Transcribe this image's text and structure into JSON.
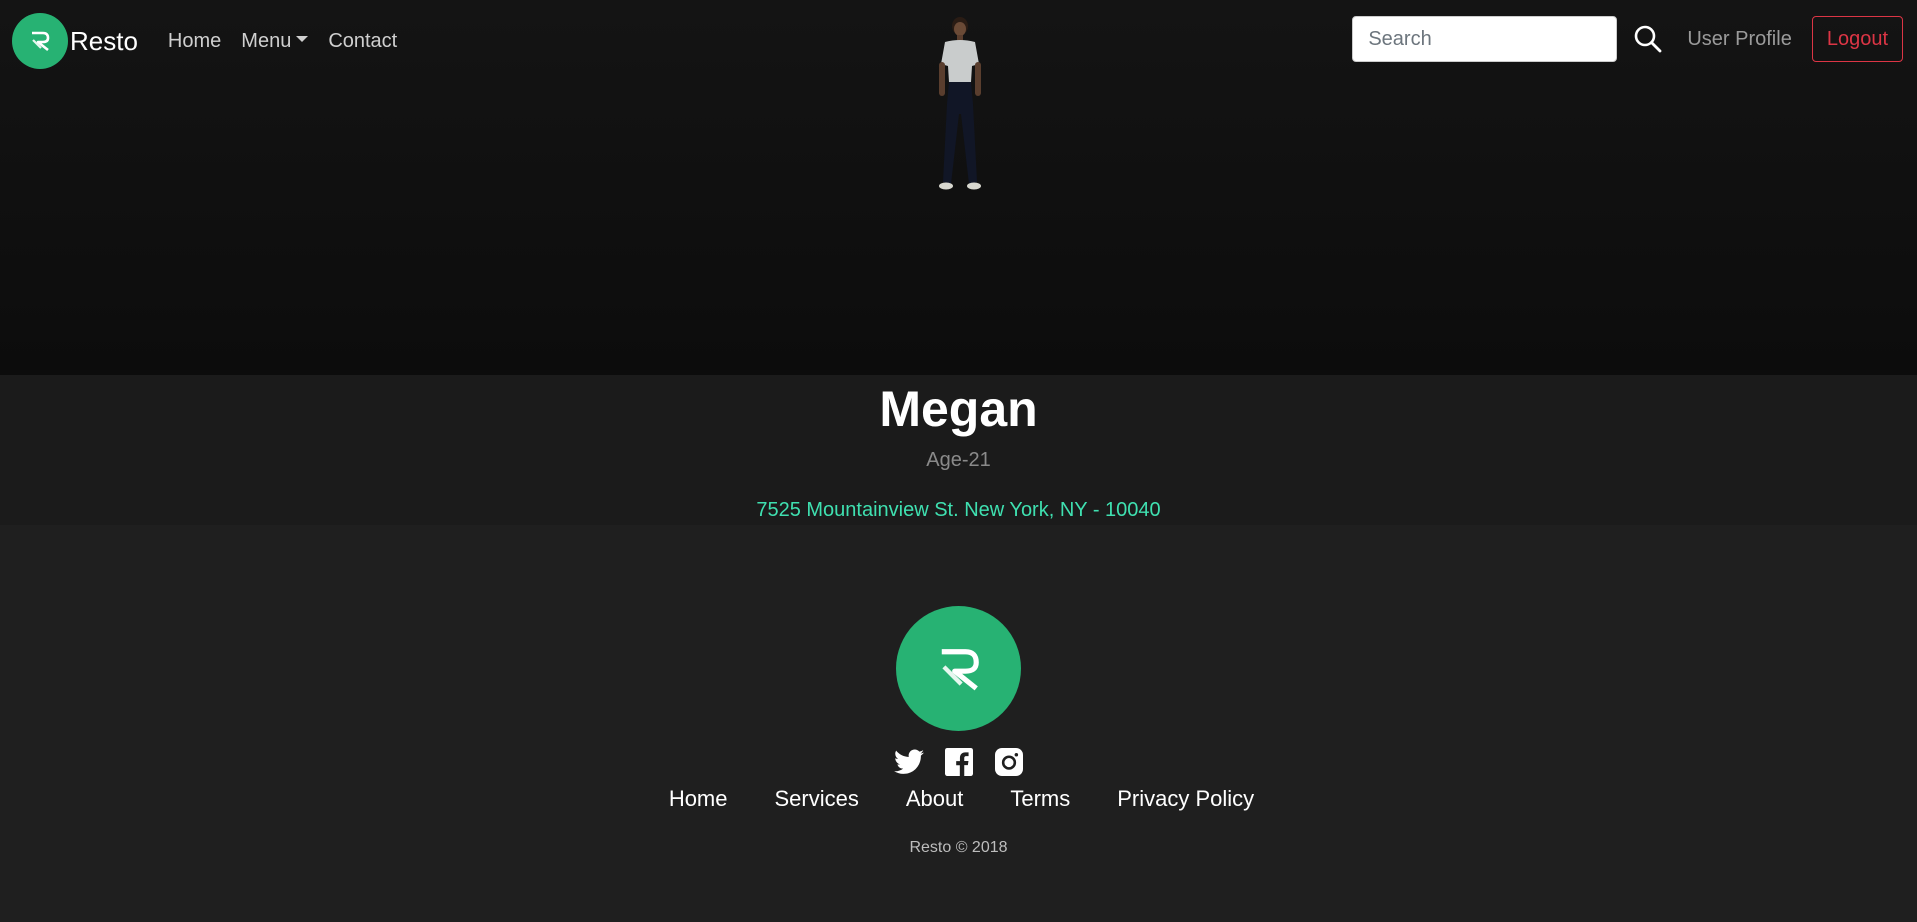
{
  "brand": {
    "name": "Resto",
    "logo_icon": "resto-r-logo-icon",
    "accent_color": "#27b273"
  },
  "nav": {
    "items": [
      {
        "label": "Home"
      },
      {
        "label": "Menu",
        "has_dropdown": true
      },
      {
        "label": "Contact"
      }
    ],
    "search_placeholder": "Search",
    "search_value": "",
    "search_icon": "search-icon",
    "user_profile_label": "User Profile",
    "logout_label": "Logout",
    "logout_color": "#dc3545"
  },
  "profile": {
    "name": "Megan",
    "age": "Age-21",
    "address": "7525 Mountainview St. New York, NY - 10040",
    "address_color": "#3fe0b0",
    "avatar_icon": "3d-avatar-figure"
  },
  "footer": {
    "social_icons": [
      "twitter-icon",
      "facebook-icon",
      "instagram-icon"
    ],
    "links": [
      "Home",
      "Services",
      "About",
      "Terms",
      "Privacy Policy"
    ],
    "copyright": "Resto © 2018"
  }
}
